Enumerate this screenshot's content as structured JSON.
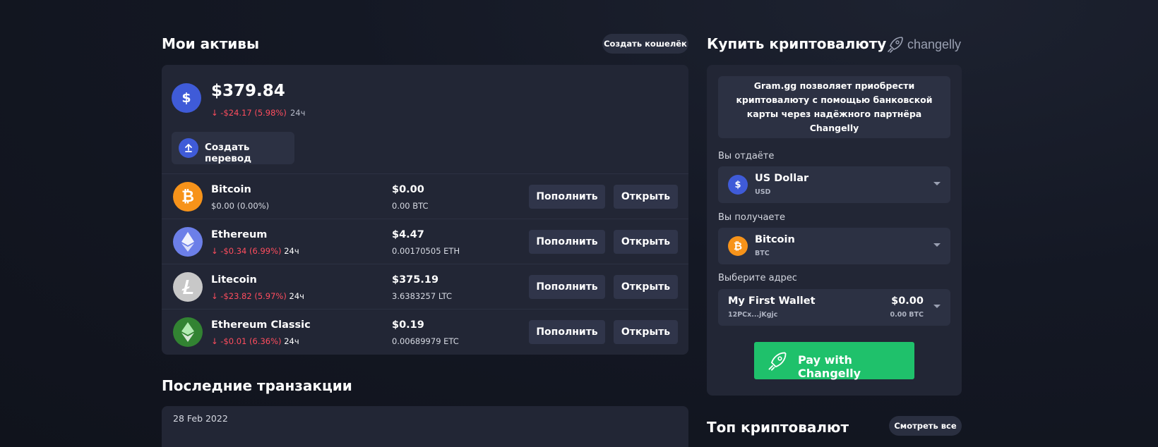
{
  "assets": {
    "title": "Мои активы",
    "create_wallet_label": "Создать кошелёк",
    "total": "$379.84",
    "total_change": "↓ -$24.17 (5.98%)",
    "total_period": "24ч",
    "transfer_label": "Создать перевод",
    "deposit_label": "Пополнить",
    "open_label": "Открыть",
    "coins": [
      {
        "name": "Bitcoin",
        "change": "$0.00 (0.00%)",
        "period": "",
        "value": "$0.00",
        "amount": "0.00 BTC",
        "color": "#f7931a"
      },
      {
        "name": "Ethereum",
        "change": "↓ -$0.34 (6.99%)",
        "period": "24ч",
        "value": "$4.47",
        "amount": "0.00170505 ETH",
        "color": "#6c7fe8"
      },
      {
        "name": "Litecoin",
        "change": "↓ -$23.82 (5.97%)",
        "period": "24ч",
        "value": "$375.19",
        "amount": "3.6383257 LTC",
        "color": "#c8c8c8"
      },
      {
        "name": "Ethereum Classic",
        "change": "↓ -$0.01 (6.36%)",
        "period": "24ч",
        "value": "$0.19",
        "amount": "0.00689979 ETC",
        "color": "#328332"
      }
    ]
  },
  "transactions": {
    "title": "Последние транзакции",
    "first_date": "28 Feb 2022"
  },
  "buy": {
    "title": "Купить криптовалюту",
    "brand": "changelly",
    "info_text": "Gram.gg позволяет приобрести криптовалюту с помощью банковской карты через надёжного партнёра Changelly",
    "give_label": "Вы отдаёте",
    "give_currency": "US Dollar",
    "give_code": "USD",
    "get_label": "Вы получаете",
    "get_currency": "Bitcoin",
    "get_code": "BTC",
    "address_label": "Выберите адрес",
    "wallet_name": "My First Wallet",
    "wallet_addr": "12PCx...jKgjc",
    "wallet_value": "$0.00",
    "wallet_amount": "0.00 BTC",
    "pay_label": "Pay with Changelly"
  },
  "top": {
    "title": "Топ криптовалют",
    "see_all_label": "Смотреть все"
  },
  "colors": {
    "negative": "#ff4d5e",
    "accent_green": "#1fc16b",
    "usd_blue": "#3f5bd8"
  }
}
